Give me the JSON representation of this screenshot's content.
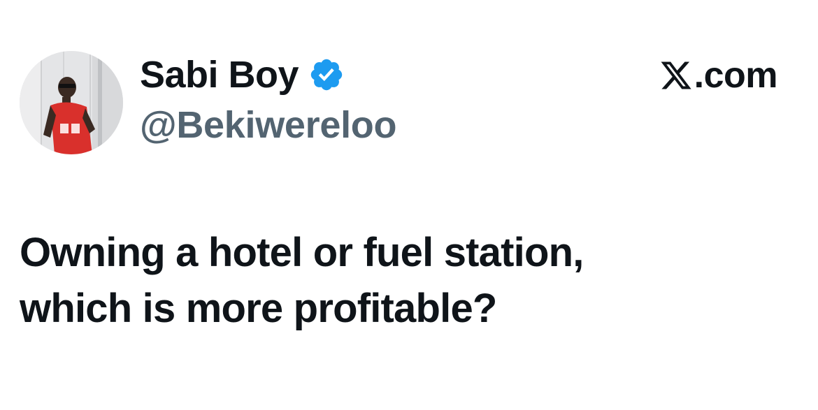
{
  "author": {
    "display_name": "Sabi Boy",
    "handle": "@Bekiwereloo",
    "verified": true,
    "verified_badge_color": "#1d9bf0",
    "avatar_icon": "profile-photo"
  },
  "brand": {
    "icon": "x-logo-icon",
    "text": ".com"
  },
  "tweet": {
    "lines": [
      "Owning a hotel or fuel station,",
      "which is more profitable?"
    ]
  },
  "colors": {
    "text_primary": "#0f1419",
    "text_secondary": "#536471",
    "background": "#ffffff"
  }
}
